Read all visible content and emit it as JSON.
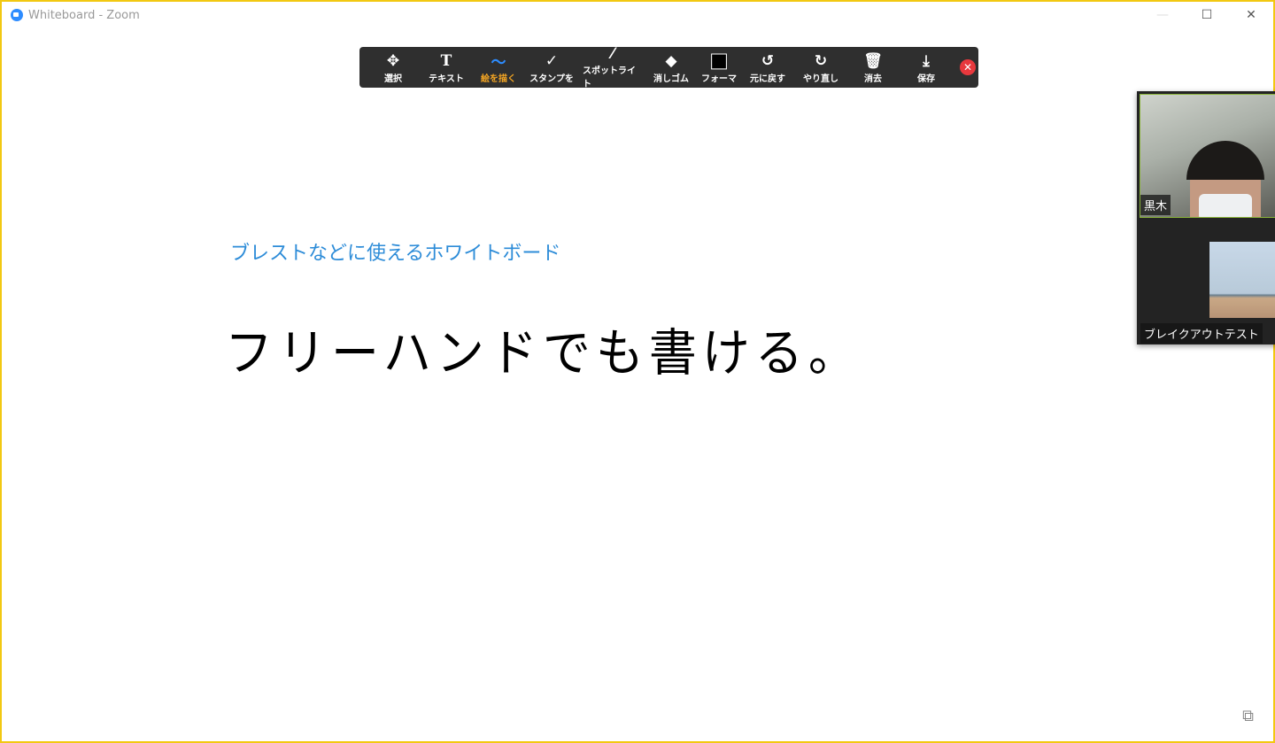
{
  "window": {
    "title": "Whiteboard - Zoom",
    "minimize": "—",
    "maximize": "☐",
    "close": "✕"
  },
  "toolbar": {
    "tools": [
      {
        "label": "選択",
        "icon": "✥"
      },
      {
        "label": "テキスト",
        "icon": "T"
      },
      {
        "label": "絵を描く",
        "icon": "〜"
      },
      {
        "label": "スタンプを",
        "icon": "✓"
      },
      {
        "label": "スポットライト",
        "icon": "⁄"
      },
      {
        "label": "消しゴム",
        "icon": "◆"
      },
      {
        "label": "フォーマ",
        "icon": "■"
      },
      {
        "label": "元に戻す",
        "icon": "↺"
      },
      {
        "label": "やり直し",
        "icon": "↻"
      },
      {
        "label": "消去",
        "icon": "🗑"
      },
      {
        "label": "保存",
        "icon": "⤓"
      }
    ],
    "close": "✕",
    "active_tool": "絵を描く"
  },
  "canvas": {
    "typed_text": "ブレストなどに使えるホワイトボード",
    "handwritten_text": "フリーハンドでも書ける。"
  },
  "participants": [
    {
      "name": "黒木"
    },
    {
      "name": "ブレイクアウトテスト"
    }
  ],
  "new_icon": "⧉"
}
